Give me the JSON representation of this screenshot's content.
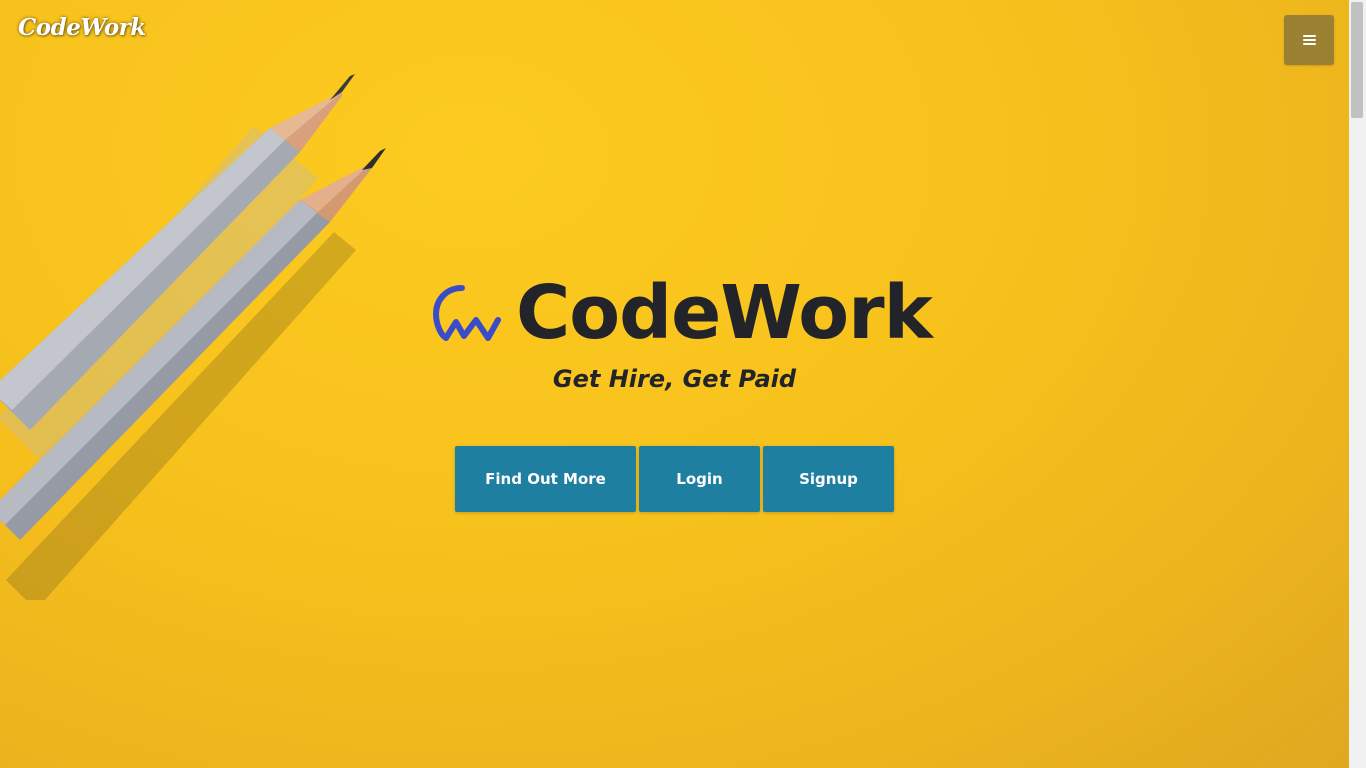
{
  "nav": {
    "brand": "CodeWork",
    "menu_icon": "hamburger-icon"
  },
  "hero": {
    "logo_icon": "codework-logo-icon",
    "title": "CodeWork",
    "tagline": "Get Hire, Get Paid",
    "buttons": [
      {
        "label": "Find Out More"
      },
      {
        "label": "Login"
      },
      {
        "label": "Signup"
      }
    ]
  },
  "colors": {
    "background": "#f7c11c",
    "button": "#1f7fa1",
    "menu_button": "#9a8031",
    "logo_icon": "#3b4cc9",
    "title_text": "#23242a"
  }
}
